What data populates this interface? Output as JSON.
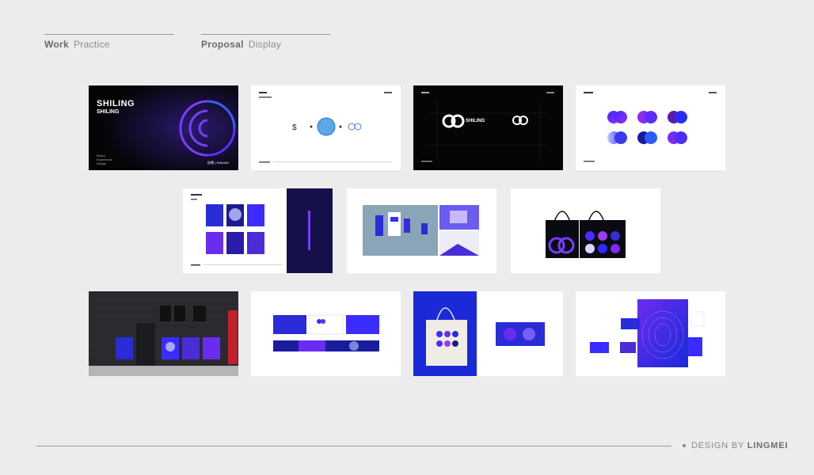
{
  "header": {
    "left": {
      "bold": "Work",
      "light": "Practice"
    },
    "right": {
      "bold": "Proposal",
      "light": "Display"
    }
  },
  "slide1": {
    "title1": "SHILING",
    "title2": "SHILING",
    "sub1": "Brand",
    "sub2": "Experience",
    "sub3": "Design",
    "footer": "拾零 | SHILING"
  },
  "slide3": {
    "brand": "SHILING"
  },
  "footer": {
    "prefix": "DESIGN BY",
    "name": "LINGMEI"
  },
  "colors": {
    "accent_purple": "#6a2cf0",
    "accent_blue": "#1a2fd8",
    "background": "#ececec"
  }
}
